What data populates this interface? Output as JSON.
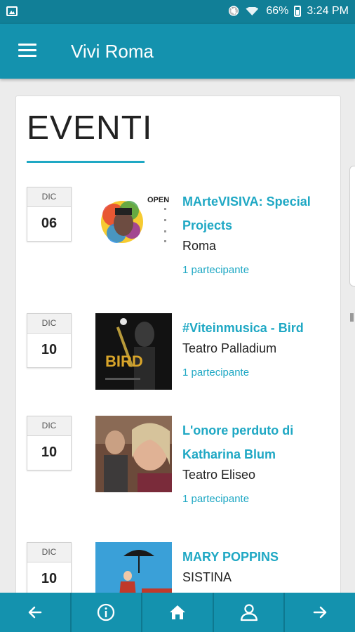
{
  "status_bar": {
    "battery": "66%",
    "time": "3:24 PM"
  },
  "app": {
    "title": "Vivi Roma"
  },
  "section": {
    "title": "EVENTI"
  },
  "events": [
    {
      "month": "DIC",
      "day": "06",
      "title": "MArteVISIVA: Special Projects",
      "place": "Roma",
      "participants": "1 partecipante"
    },
    {
      "month": "DIC",
      "day": "10",
      "title": "#Viteinmusica - Bird",
      "place": "Teatro Palladium",
      "participants": "1 partecipante"
    },
    {
      "month": "DIC",
      "day": "10",
      "title": "L'onore perduto di Katharina Blum",
      "place": "Teatro Eliseo",
      "participants": "1 partecipante"
    },
    {
      "month": "DIC",
      "day": "10",
      "title": "MARY POPPINS",
      "place": "SISTINA",
      "participants": ""
    }
  ],
  "thumb_text": {
    "bird": "BIRD",
    "open": "OPEN"
  },
  "colors": {
    "primary": "#1492ae",
    "status_bar": "#117f97",
    "accent": "#1fa8c4"
  },
  "bottom_nav": [
    {
      "icon": "arrow-left-icon"
    },
    {
      "icon": "info-icon"
    },
    {
      "icon": "home-icon"
    },
    {
      "icon": "user-icon"
    },
    {
      "icon": "arrow-right-icon"
    }
  ]
}
